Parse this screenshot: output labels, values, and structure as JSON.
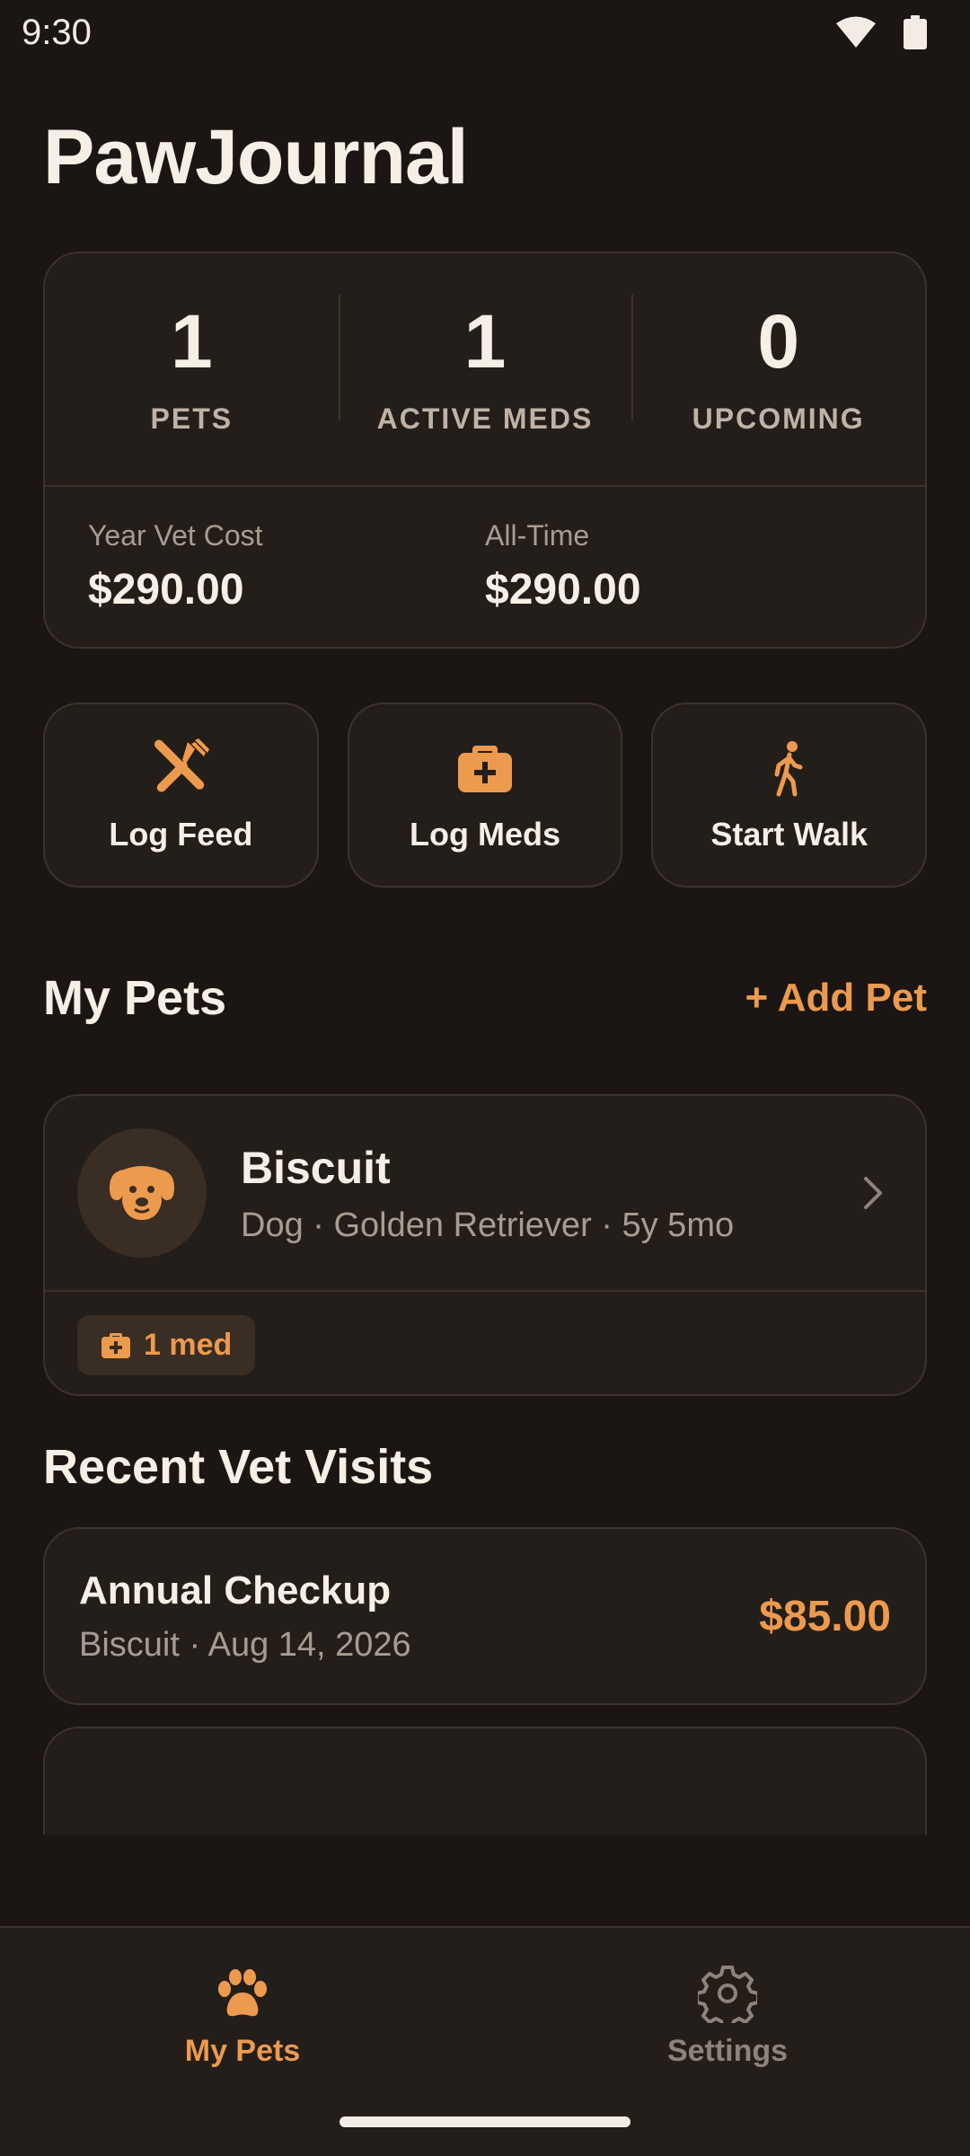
{
  "status_bar": {
    "time": "9:30"
  },
  "app": {
    "title": "PawJournal"
  },
  "stats": [
    {
      "value": "1",
      "label": "PETS"
    },
    {
      "value": "1",
      "label": "ACTIVE MEDS"
    },
    {
      "value": "0",
      "label": "UPCOMING"
    }
  ],
  "costs": {
    "year_label": "Year Vet Cost",
    "year_value": "$290.00",
    "alltime_label": "All-Time",
    "alltime_value": "$290.00"
  },
  "quick_actions": [
    {
      "label": "Log Feed",
      "icon": "utensils-icon"
    },
    {
      "label": "Log Meds",
      "icon": "medkit-icon"
    },
    {
      "label": "Start Walk",
      "icon": "walking-icon"
    }
  ],
  "my_pets": {
    "title": "My Pets",
    "add_label": "+ Add Pet",
    "pets": [
      {
        "name": "Biscuit",
        "details": "Dog · Golden Retriever · 5y 5mo",
        "med_badge": "1 med"
      }
    ]
  },
  "vet_visits": {
    "title": "Recent Vet Visits",
    "visits": [
      {
        "title": "Annual Checkup",
        "details": "Biscuit · Aug 14, 2026",
        "cost": "$85.00"
      }
    ]
  },
  "bottom_nav": [
    {
      "label": "My Pets",
      "icon": "paw-icon",
      "active": true
    },
    {
      "label": "Settings",
      "icon": "gear-icon",
      "active": false
    }
  ],
  "colors": {
    "background": "#1b1613",
    "card": "#241e1a",
    "accent": "#ec9a4e",
    "text_primary": "#f6efe6",
    "text_secondary": "#a89c91"
  }
}
